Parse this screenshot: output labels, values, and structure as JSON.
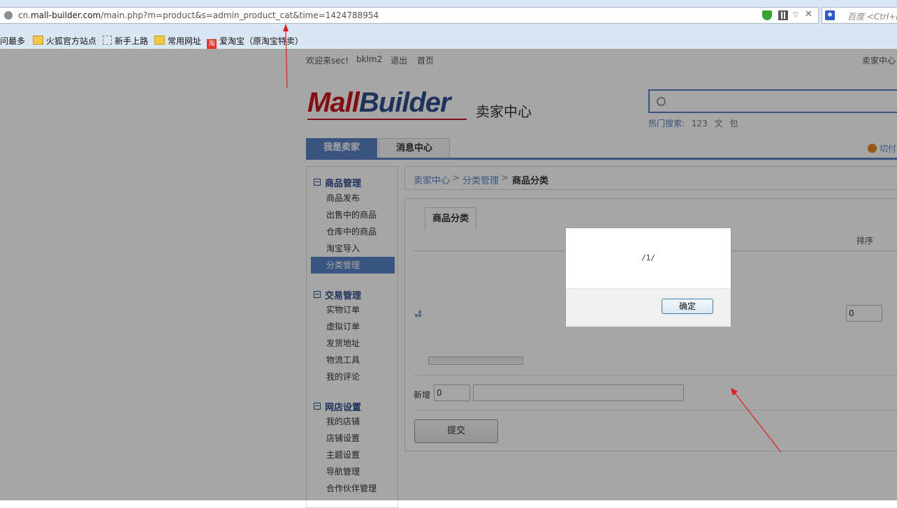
{
  "browser": {
    "url_prefix": "cn.",
    "url_domain": "mall-builder.com",
    "url_path": "/main.php?m=product&s=admin_product_cat&time=1424788954",
    "search_placeholder": "百度 <Ctrl+K>",
    "bookmarks": [
      "访问最多",
      "火狐官方站点",
      "新手上路",
      "常用网址",
      "爱淘宝（原淘宝特卖）"
    ],
    "taobao_icon": "淘"
  },
  "topbar": {
    "welcome": "欢迎来sec!",
    "user": "bklm2",
    "logout": "退出",
    "home": "首页",
    "seller_center": "卖家中心"
  },
  "brand": {
    "logo_m": "M",
    "logo_rest_red": "all",
    "logo_rest_blue": "Builder",
    "subtitle": "卖家中心",
    "accent": "#5a83c4",
    "logo_red": "#c8161d"
  },
  "search": {
    "hot_label": "热门搜索:",
    "hot_keywords": [
      "123",
      "文",
      "包"
    ]
  },
  "nav": {
    "tabs": [
      "我是卖家",
      "消息中心"
    ],
    "switch_label": "切付"
  },
  "sidebar": {
    "sections": [
      {
        "title": "商品管理",
        "items": [
          "商品发布",
          "出售中的商品",
          "仓库中的商品",
          "淘宝导入",
          "分类管理"
        ]
      },
      {
        "title": "交易管理",
        "items": [
          "实物订单",
          "虚拟订单",
          "发货地址",
          "物流工具",
          "我的评论"
        ]
      },
      {
        "title": "网店设置",
        "items": [
          "我的店铺",
          "店铺设置",
          "主题设置",
          "导航管理",
          "合作伙伴管理"
        ]
      }
    ],
    "active_item": "分类管理"
  },
  "breadcrumb": {
    "items": [
      "卖家中心",
      "分类管理",
      "商品分类"
    ],
    "separator": ">"
  },
  "main": {
    "tab_label": "商品分类",
    "col_sort": "排序",
    "sort_value": "0",
    "add_label": "新增",
    "add_sort_value": "0",
    "submit_label": "提交"
  },
  "dialog": {
    "message": "/1/",
    "ok_label": "确定"
  }
}
